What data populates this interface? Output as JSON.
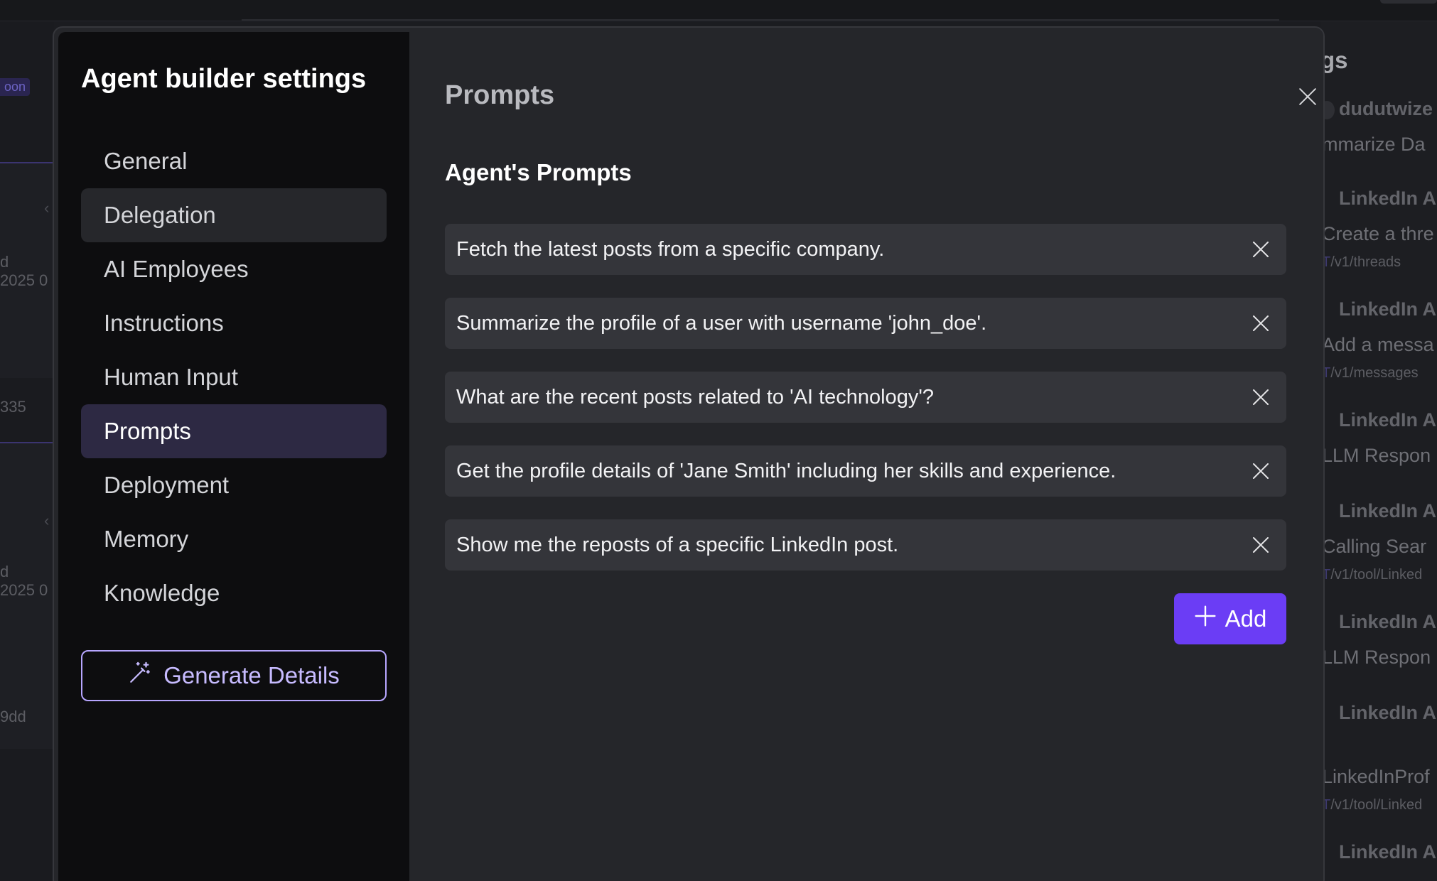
{
  "modal": {
    "title": "Agent builder settings",
    "nav": [
      {
        "label": "General"
      },
      {
        "label": "Delegation"
      },
      {
        "label": "AI Employees"
      },
      {
        "label": "Instructions"
      },
      {
        "label": "Human Input"
      },
      {
        "label": "Prompts"
      },
      {
        "label": "Deployment"
      },
      {
        "label": "Memory"
      },
      {
        "label": "Knowledge"
      }
    ],
    "active_nav": "Prompts",
    "generate_label": "Generate Details",
    "content": {
      "title": "Prompts",
      "section_title": "Agent's Prompts",
      "prompts": [
        "Fetch the latest posts from a specific company.",
        "Summarize the profile of a user with username 'john_doe'.",
        "What are the recent posts related to 'AI technology'?",
        "Get the profile details of 'Jane Smith' including her skills and experience.",
        "Show me the reposts of a specific LinkedIn post."
      ],
      "add_label": "Add"
    }
  },
  "background": {
    "left": {
      "tag": "oon",
      "texts": [
        "d",
        "2025 0",
        "335",
        "d",
        "2025 0",
        "9dd"
      ]
    },
    "right": {
      "title": "gs",
      "user": "dudutwize",
      "items": [
        {
          "text": "mmarize Da"
        },
        {
          "heading": "LinkedIn A",
          "text": "Create a thre",
          "method": "T",
          "path": "/v1/threads"
        },
        {
          "heading": "LinkedIn A",
          "text": "Add a messa",
          "method": "T",
          "path": "/v1/messages"
        },
        {
          "heading": "LinkedIn A",
          "text": "LLM Respon"
        },
        {
          "heading": "LinkedIn A",
          "text": "Calling Sear",
          "method": "T",
          "path": "/v1/tool/Linked"
        },
        {
          "heading": "LinkedIn A",
          "text": "LLM Respon"
        },
        {
          "heading": "LinkedIn A",
          "text": "LinkedInProf",
          "method": "T",
          "path": "/v1/tool/Linked"
        },
        {
          "heading": "LinkedIn A"
        }
      ]
    }
  },
  "colors": {
    "accent": "#6b3df5",
    "active_nav_bg": "#2d2943",
    "generate_border": "#b7a6ff"
  }
}
